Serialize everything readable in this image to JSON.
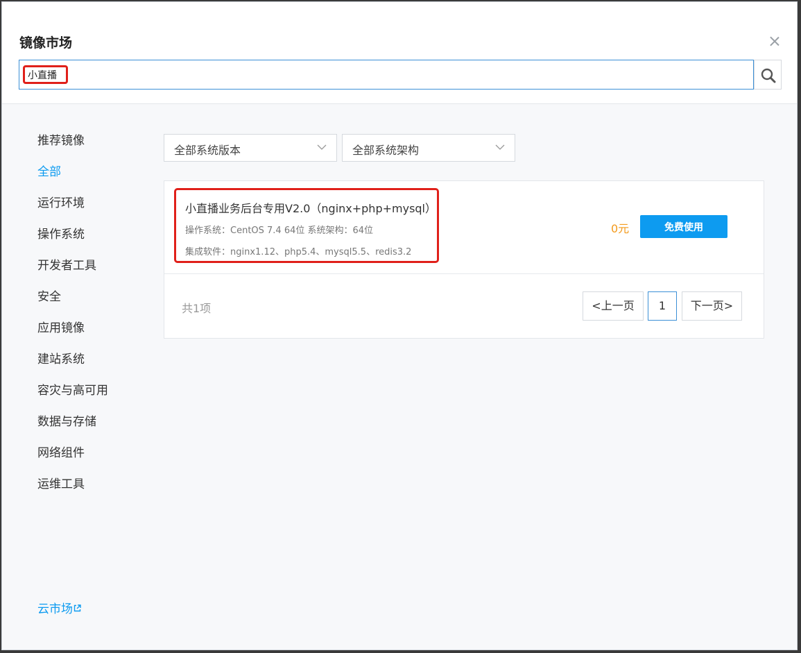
{
  "dialog": {
    "title": "镜像市场",
    "close_icon": "close-icon"
  },
  "search": {
    "value": "小直播",
    "icon": "search-icon"
  },
  "sidebar": {
    "active": "全部",
    "items": [
      {
        "label": "推荐镜像"
      },
      {
        "label": "全部"
      },
      {
        "label": "运行环境"
      },
      {
        "label": "操作系统"
      },
      {
        "label": "开发者工具"
      },
      {
        "label": "安全"
      },
      {
        "label": "应用镜像"
      },
      {
        "label": "建站系统"
      },
      {
        "label": "容灾与高可用"
      },
      {
        "label": "数据与存储"
      },
      {
        "label": "网络组件"
      },
      {
        "label": "运维工具"
      }
    ],
    "market_link": "云市场",
    "market_icon": "external-link-icon"
  },
  "filters": {
    "version": "全部系统版本",
    "arch": "全部系统架构",
    "icon": "chevron-down-icon"
  },
  "result": {
    "title": "小直播业务后台专用V2.0（nginx+php+mysql）",
    "os_line": "操作系统：CentOS 7.4 64位   系统架构：64位",
    "software_line": "集成软件：nginx1.12、php5.4、mysql5.5、redis3.2",
    "price": "0元",
    "action": "免费使用"
  },
  "pagination": {
    "total": "共1项",
    "prev": "<上一页",
    "current": "1",
    "next": "下一页>"
  },
  "colors": {
    "accent": "#0d9bf0",
    "highlight": "#e0201a",
    "price": "#f39a1b"
  }
}
